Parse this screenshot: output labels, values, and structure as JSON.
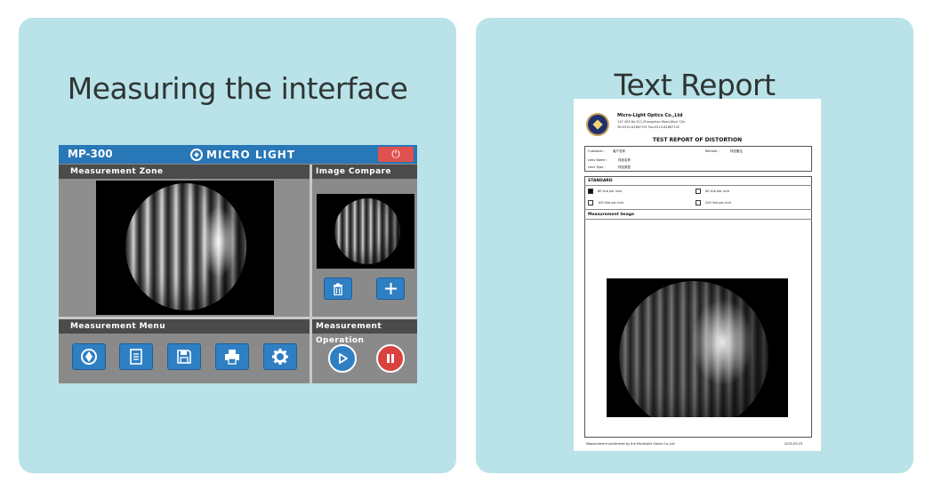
{
  "left_panel": {
    "title": "Measuring the interface",
    "device": {
      "model": "MP-300",
      "brand": "MICRO LIGHT",
      "sections": {
        "measurement_zone": "Measurement Zone",
        "image_compare": "Image Compare",
        "measurement_menu": "Measurement Menu",
        "measurement_operation": "Measurement Operation"
      },
      "icons": {
        "power": "power-icon",
        "trash": "trash-icon",
        "plus": "plus-icon",
        "logo": "logo-icon",
        "document": "document-icon",
        "save": "save-icon",
        "print": "print-icon",
        "settings": "gear-icon",
        "play": "play-icon",
        "pause": "pause-icon"
      },
      "colors": {
        "accent": "#2877b7",
        "header": "#4b4b4b",
        "power": "#e0524f",
        "pause": "#d9423e"
      }
    }
  },
  "right_panel": {
    "title": "Text Report",
    "report": {
      "company": "Micro-Light Optics Co.,Ltd",
      "address": "11F-403,No.511,Zhongshan Road,Wuxi City",
      "tel": "Tel:0510-81887191  Fax:0510-81887192",
      "title": "TEST REPORT OF DISTORTION",
      "fields": {
        "customer_label": "Customer :",
        "customer_value": "客户名称",
        "remark_label": "Remark :",
        "remark_value": "样品备注",
        "lens_name_label": "Lens Name :",
        "lens_name_value": "样品名称",
        "lens_type_label": "Lens Type :",
        "lens_type_value": "样品类型"
      },
      "standard_label": "STANDARD",
      "options": [
        {
          "label": "80 line per inch",
          "checked": true
        },
        {
          "label": "60 line per inch",
          "checked": false
        },
        {
          "label": "100 line per inch",
          "checked": false
        },
        {
          "label": "200 line per inch",
          "checked": false
        }
      ],
      "image_label": "Measurement Image",
      "footer_left": "Measurement performed by the Microlight Optics Co.,Ltd",
      "footer_right": "2020-09-23"
    }
  }
}
